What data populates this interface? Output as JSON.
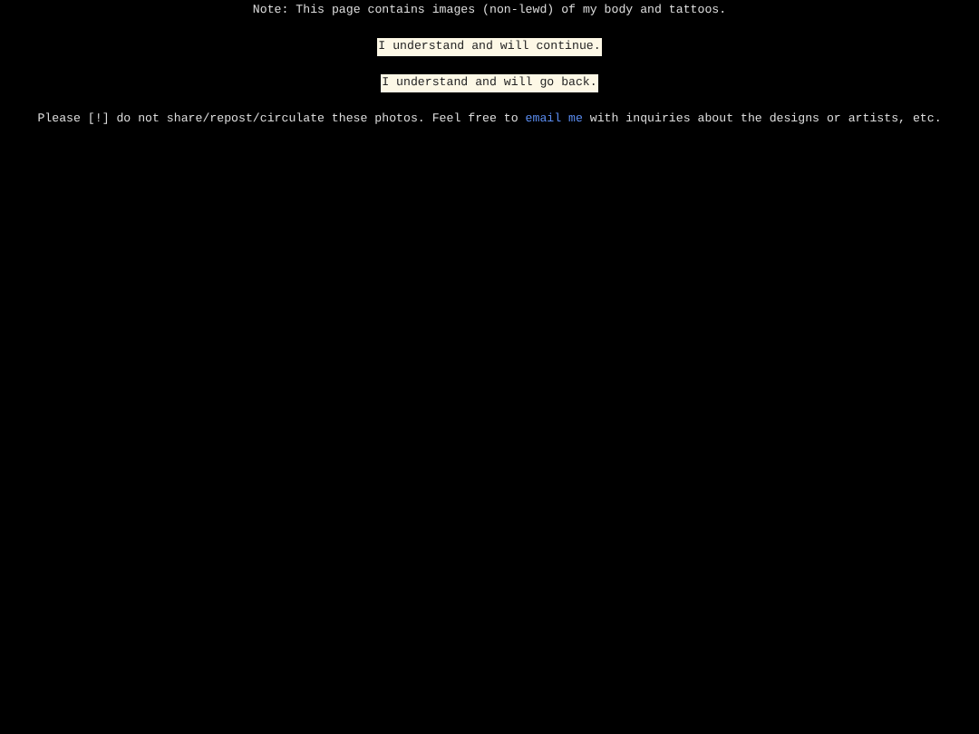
{
  "note": "Note: This page contains images (non-lewd) of my body and tattoos.",
  "choices": [
    {
      "label": "I understand and will continue."
    },
    {
      "label": "I understand and will go back."
    }
  ],
  "notice": {
    "before": "Please [!] do not share/repost/circulate these photos. Feel free to ",
    "link": "email me",
    "after": " with inquiries about the designs or artists, etc."
  }
}
